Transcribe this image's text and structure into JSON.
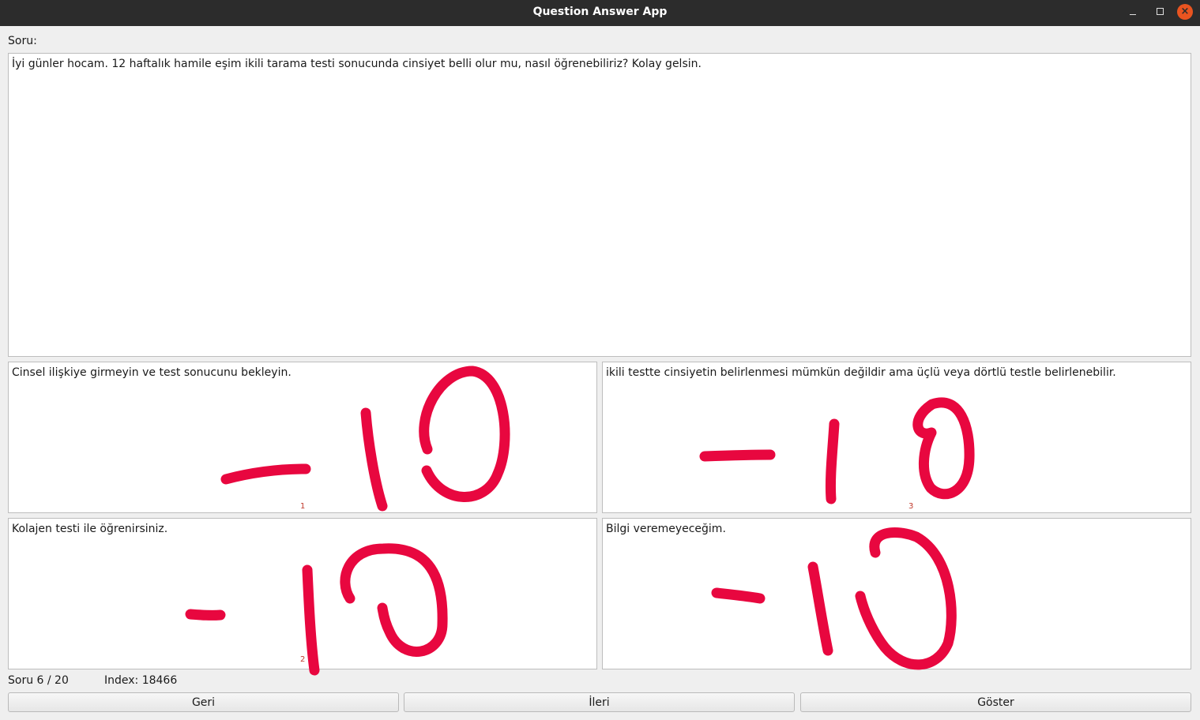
{
  "window": {
    "title": "Question Answer App"
  },
  "question": {
    "label": "Soru:",
    "text": "İyi günler hocam. 12 haftalık hamile eşim ikili tarama testi sonucunda cinsiyet belli olur mu, nasıl öğrenebiliriz? Kolay gelsin."
  },
  "answers": [
    {
      "text": "Cinsel ilişkiye girmeyin ve test sonucunu bekleyin.",
      "number": "1",
      "annotation": "-10"
    },
    {
      "text": "ikili testte cinsiyetin belirlenmesi mümkün değildir ama üçlü veya dörtlü testle belirlenebilir.",
      "number": "3",
      "annotation": "-10"
    },
    {
      "text": "Kolajen testi ile öğrenirsiniz.",
      "number": "2",
      "annotation": "-10"
    },
    {
      "text": "Bilgi veremeyeceğim.",
      "number": "",
      "annotation": "-10"
    }
  ],
  "status": {
    "progress": "Soru 6 / 20",
    "index": "Index: 18466"
  },
  "buttons": {
    "back": "Geri",
    "next": "İleri",
    "show": "Göster"
  },
  "colors": {
    "annotation_ink": "#e8073f",
    "titlebar": "#2c2c2c",
    "close_button": "#e95420"
  }
}
